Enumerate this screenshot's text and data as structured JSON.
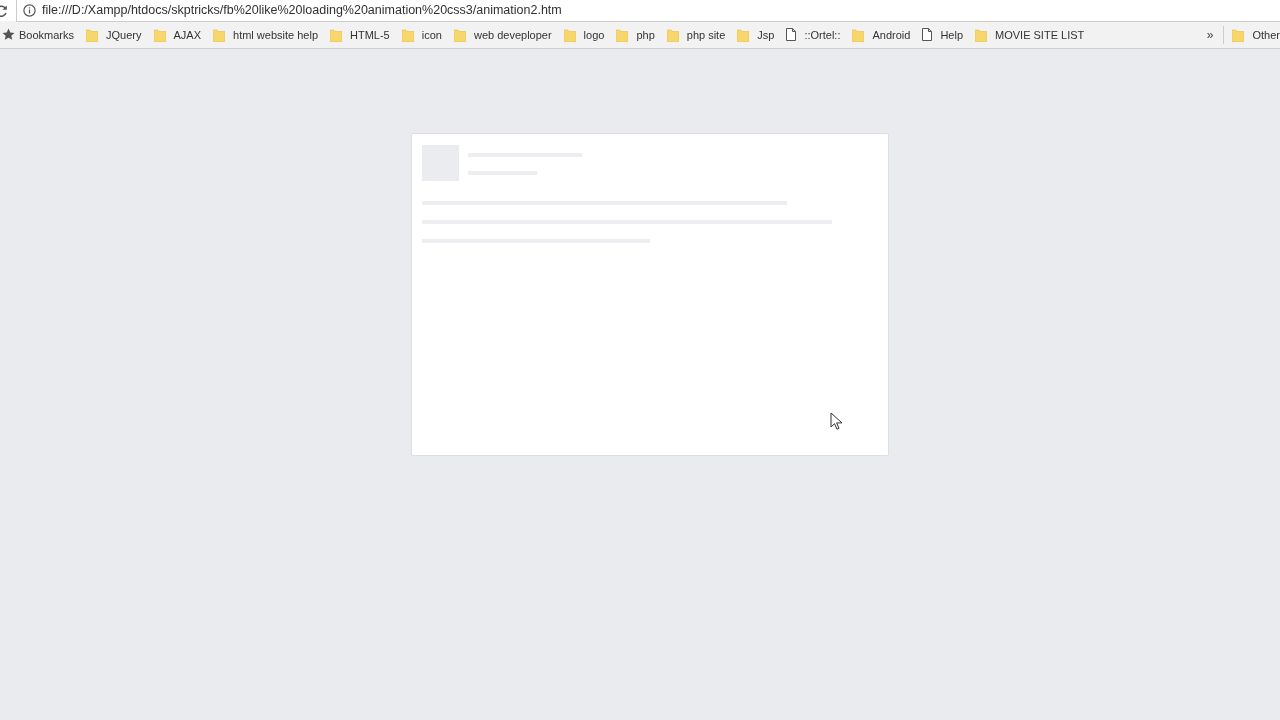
{
  "address_bar": {
    "url": "file:///D:/Xampp/htdocs/skptricks/fb%20like%20loading%20animation%20css3/animation2.htm"
  },
  "bookmarks_bar": {
    "label": "Bookmarks",
    "items": [
      {
        "kind": "folder",
        "label": "JQuery"
      },
      {
        "kind": "folder",
        "label": "AJAX"
      },
      {
        "kind": "folder",
        "label": "html website help"
      },
      {
        "kind": "folder",
        "label": "HTML-5"
      },
      {
        "kind": "folder",
        "label": "icon"
      },
      {
        "kind": "folder",
        "label": "web deveploper"
      },
      {
        "kind": "folder",
        "label": "logo"
      },
      {
        "kind": "folder",
        "label": "php"
      },
      {
        "kind": "folder",
        "label": "php site"
      },
      {
        "kind": "folder",
        "label": "Jsp"
      },
      {
        "kind": "page",
        "label": "::Ortel::"
      },
      {
        "kind": "folder",
        "label": "Android"
      },
      {
        "kind": "page",
        "label": "Help"
      },
      {
        "kind": "folder",
        "label": "MOVIE SITE LIST"
      }
    ],
    "overflow": "»",
    "other": {
      "kind": "folder",
      "label": "Other"
    }
  }
}
